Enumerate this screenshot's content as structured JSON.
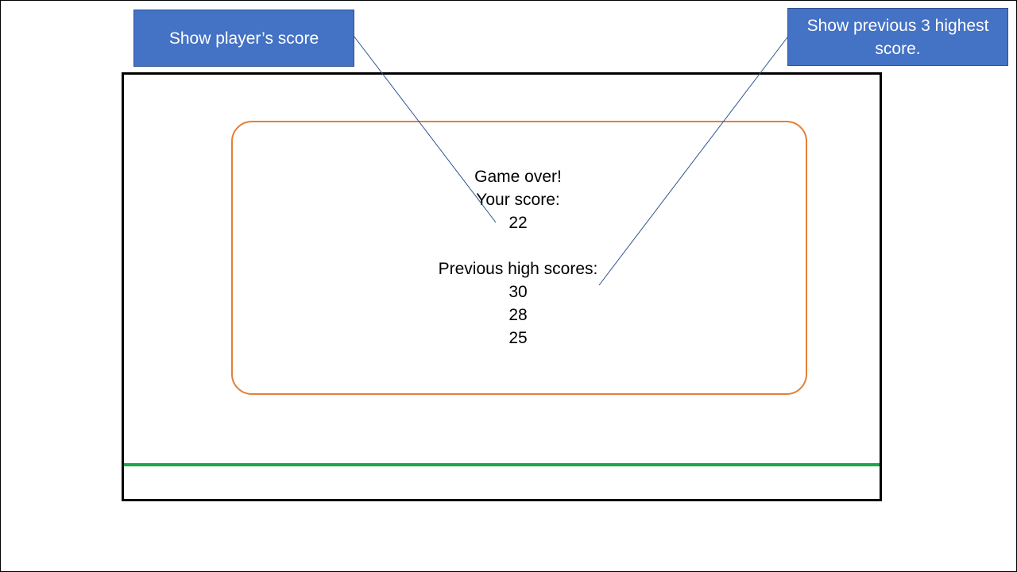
{
  "game_over": {
    "title": "Game over!",
    "your_score_label": "Your score:",
    "your_score_value": "22",
    "high_scores_label": "Previous high scores:",
    "high_scores": [
      "30",
      "28",
      "25"
    ]
  },
  "callouts": {
    "player_score": "Show player’s score",
    "high_scores": "Show previous 3 highest score."
  },
  "colors": {
    "panel_border": "#e47f35",
    "ground_line": "#1aa64b",
    "callout_fill": "#4472c4",
    "leader_line": "#2f528f"
  }
}
